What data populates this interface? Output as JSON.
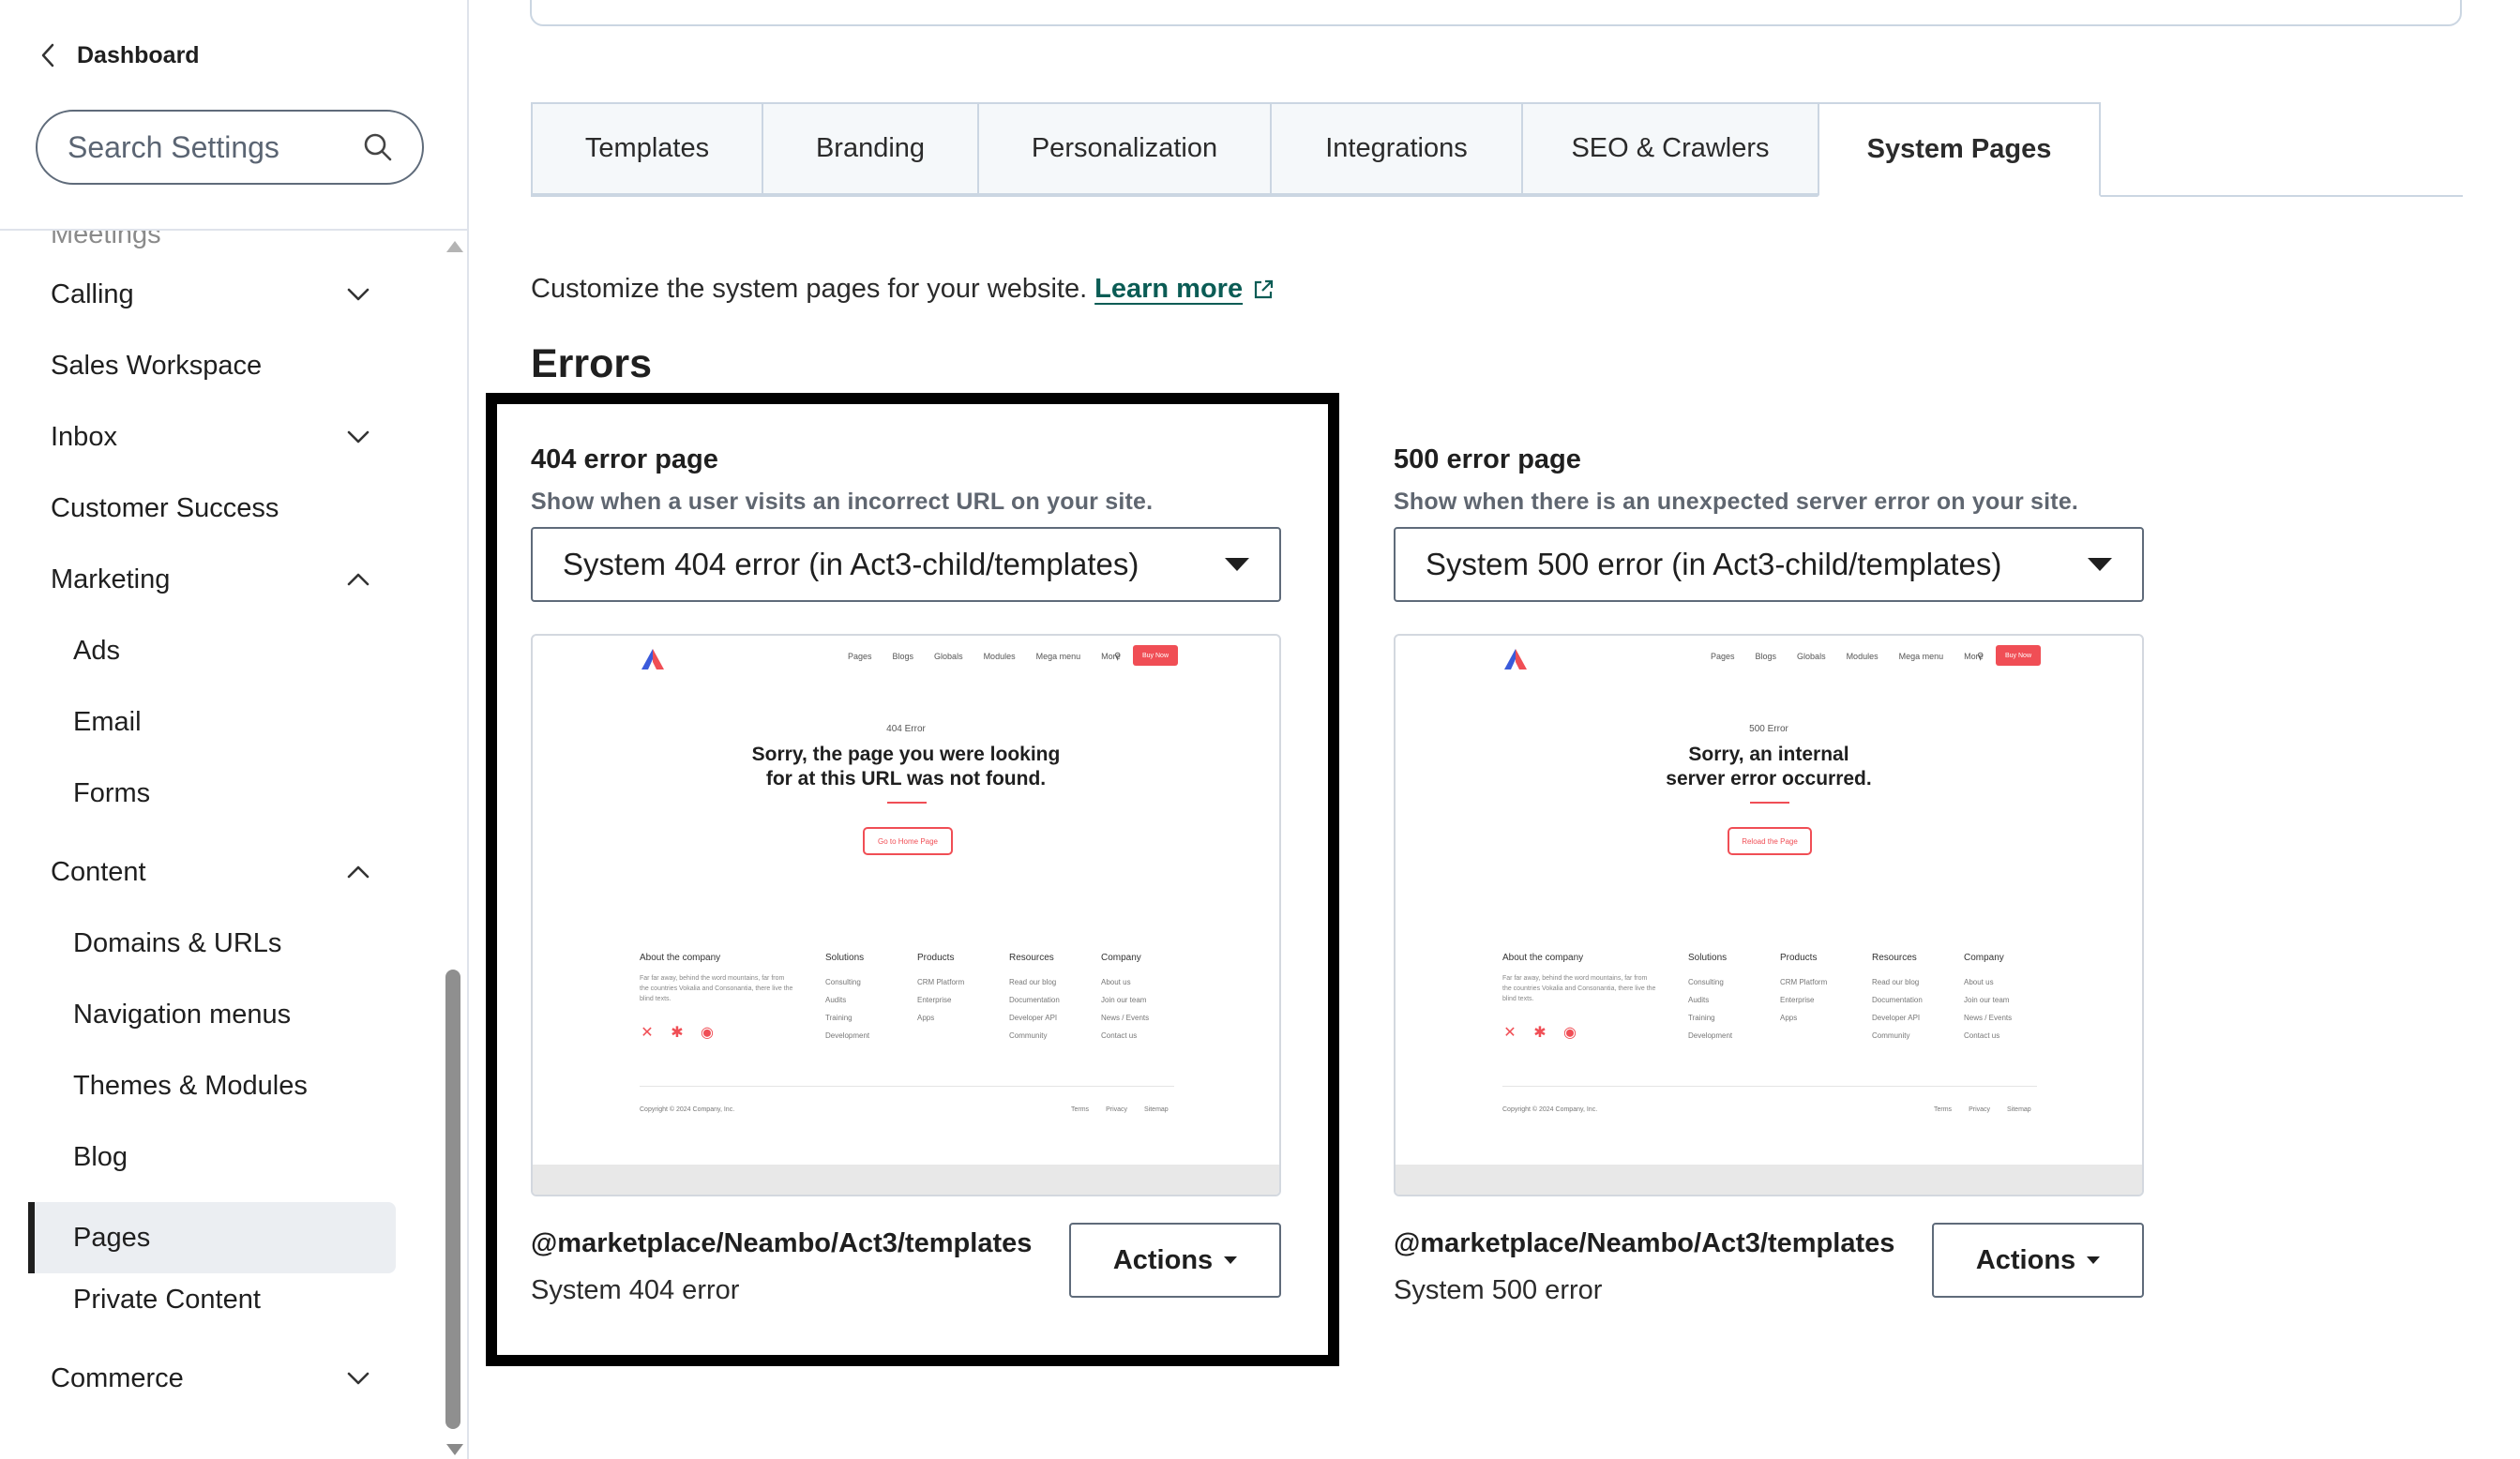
{
  "sidebar": {
    "back_label": "Dashboard",
    "search_placeholder": "Search Settings",
    "clipped_item": "Meetings",
    "items": [
      {
        "label": "Calling",
        "expandable": true,
        "expanded": false
      },
      {
        "label": "Sales Workspace"
      },
      {
        "label": "Inbox",
        "expandable": true,
        "expanded": false
      },
      {
        "label": "Customer Success"
      },
      {
        "label": "Marketing",
        "expandable": true,
        "expanded": true
      },
      {
        "label": "Ads",
        "sub": true
      },
      {
        "label": "Email",
        "sub": true
      },
      {
        "label": "Forms",
        "sub": true
      },
      {
        "label": "Content",
        "expandable": true,
        "expanded": true
      },
      {
        "label": "Domains & URLs",
        "sub": true
      },
      {
        "label": "Navigation menus",
        "sub": true
      },
      {
        "label": "Themes & Modules",
        "sub": true
      },
      {
        "label": "Blog",
        "sub": true
      },
      {
        "label": "Pages",
        "sub": true,
        "active": true
      },
      {
        "label": "Private Content",
        "sub": true
      },
      {
        "label": "Commerce",
        "expandable": true,
        "expanded": false
      }
    ]
  },
  "tabs": [
    {
      "label": "Templates"
    },
    {
      "label": "Branding"
    },
    {
      "label": "Personalization"
    },
    {
      "label": "Integrations"
    },
    {
      "label": "SEO & Crawlers"
    },
    {
      "label": "System Pages",
      "active": true
    }
  ],
  "intro": {
    "text": "Customize the system pages for your website.",
    "link_label": "Learn more"
  },
  "section_title": "Errors",
  "cards": {
    "e404": {
      "title": "404 error page",
      "description": "Show when a user visits an incorrect URL on your site.",
      "selected": "System 404 error (in Act3-child/templates)",
      "template_path": "@marketplace/Neambo/Act3/templates",
      "template_name": "System 404 error",
      "actions_label": "Actions",
      "preview": {
        "eyebrow": "404 Error",
        "heading": "Sorry, the page you were looking\nfor at this URL was not found.",
        "button": "Go to Home Page"
      }
    },
    "e500": {
      "title": "500 error page",
      "description": "Show when there is an unexpected server error on your site.",
      "selected": "System 500 error (in Act3-child/templates)",
      "template_path": "@marketplace/Neambo/Act3/templates",
      "template_name": "System 500 error",
      "actions_label": "Actions",
      "preview": {
        "eyebrow": "500 Error",
        "heading": "Sorry, an internal\nserver error occurred.",
        "button": "Reload the Page"
      }
    }
  },
  "preview_common": {
    "nav": [
      "Pages",
      "Blogs",
      "Globals",
      "Modules",
      "Mega menu",
      "More"
    ],
    "buy": "Buy Now",
    "about_head": "About the company",
    "about_text": "Far far away, behind the word mountains, far from the countries Vokalia and Consonantia, there live the blind texts.",
    "columns": [
      {
        "head": "Solutions",
        "items": "Consulting\nAudits\nTraining\nDevelopment"
      },
      {
        "head": "Products",
        "items": "CRM Platform\nEnterprise\nApps"
      },
      {
        "head": "Resources",
        "items": "Read our blog\nDocumentation\nDeveloper API\nCommunity"
      },
      {
        "head": "Company",
        "items": "About us\nJoin our team\nNews / Events\nContact us"
      }
    ],
    "copyright": "Copyright © 2024 Company, Inc.",
    "legal": [
      "Terms",
      "Privacy",
      "Sitemap"
    ]
  },
  "colors": {
    "accent_link": "#0b5c55",
    "preview_accent": "#f04e55",
    "highlight_border": "#000000"
  }
}
